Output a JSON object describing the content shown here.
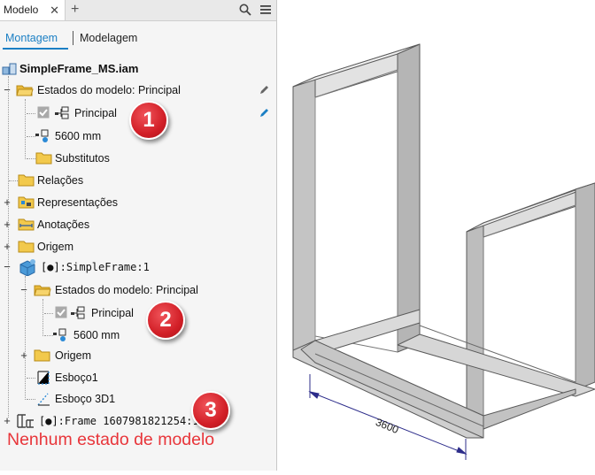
{
  "browser": {
    "tab_label": "Modelo",
    "close_glyph": "✕",
    "add_glyph": "+",
    "modes": {
      "active": "Montagem",
      "inactive": "Modelagem"
    }
  },
  "tree": {
    "root": "SimpleFrame_MS.iam",
    "model_states_top": "Estados do modelo: Principal",
    "principal_top": "Principal",
    "length_top": "5600 mm",
    "substitutes": "Substitutos",
    "relations": "Relações",
    "representations": "Representações",
    "annotations": "Anotações",
    "origin_top": "Origem",
    "part": "[●]:SimpleFrame:1",
    "model_states_part": "Estados do modelo: Principal",
    "principal_part": "Principal",
    "length_part": "5600 mm",
    "origin_part": "Origem",
    "sketch1": "Esboço1",
    "sketch3d": "Esboço 3D1",
    "frame": "[●]:Frame 1607981821254:1"
  },
  "callouts": {
    "one": "1",
    "two": "2",
    "three": "3"
  },
  "note": "Nenhum estado de modelo",
  "viewport": {
    "dimension": "3600"
  },
  "colors": {
    "accent": "#1b7fc4",
    "callout": "#d21f27",
    "note": "#e8353a",
    "folder": "#f2c94c"
  }
}
